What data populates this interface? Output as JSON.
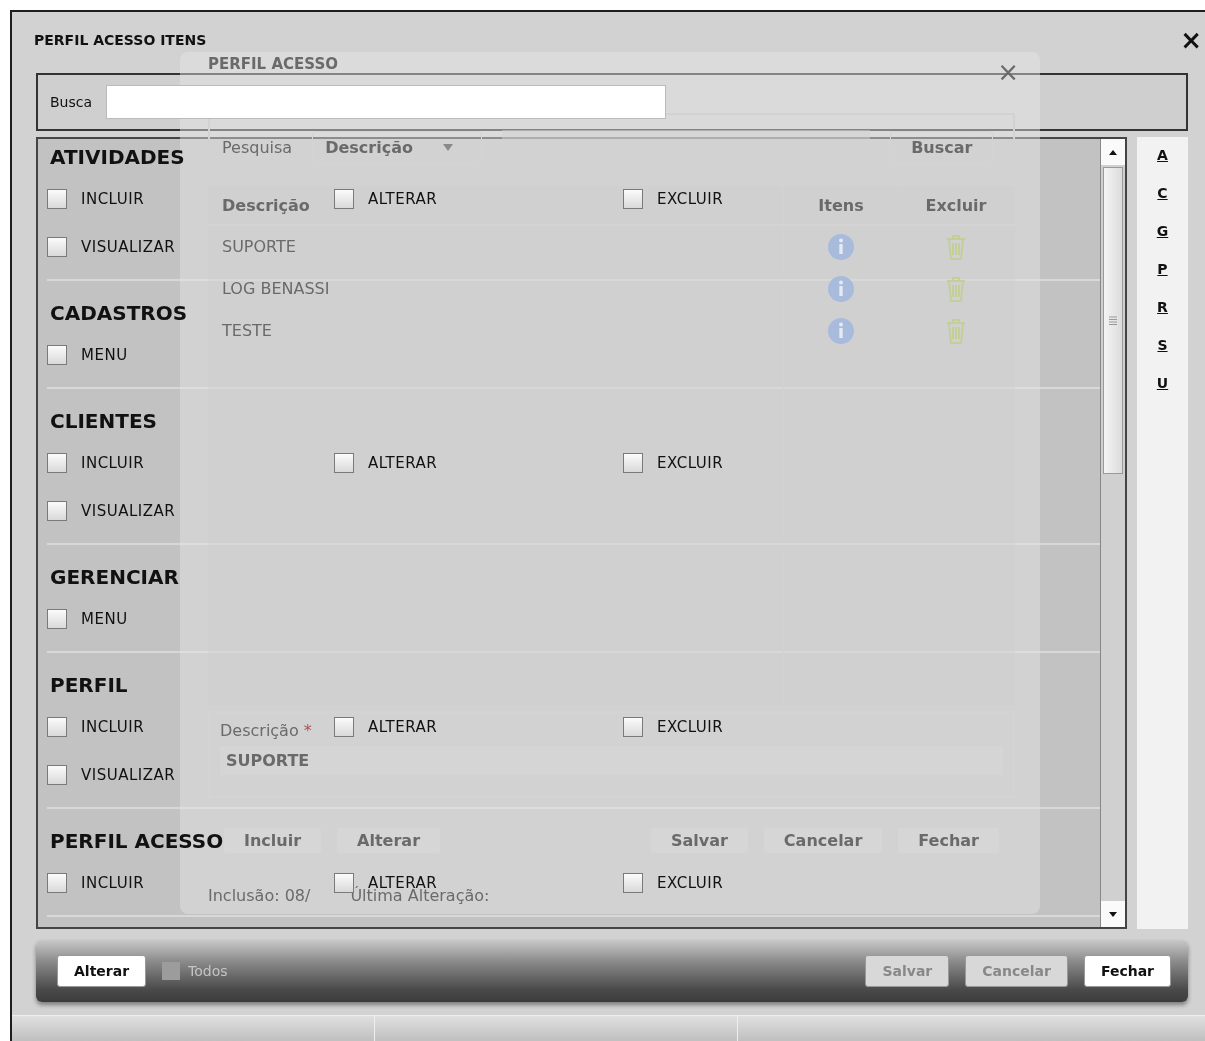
{
  "window": {
    "title": "PERFIL ACESSO ITENS",
    "close": "×"
  },
  "search": {
    "label": "Busca"
  },
  "sections": [
    {
      "title": "ATIVIDADES",
      "items": [
        {
          "label": "INCLUIR",
          "checked": false
        },
        {
          "label": "ALTERAR",
          "checked": false
        },
        {
          "label": "EXCLUIR",
          "checked": false
        },
        {
          "label": "VISUALIZAR",
          "checked": false
        }
      ]
    },
    {
      "title": "CADASTROS",
      "items": [
        {
          "label": "MENU",
          "checked": false
        }
      ]
    },
    {
      "title": "CLIENTES",
      "items": [
        {
          "label": "INCLUIR",
          "checked": false
        },
        {
          "label": "ALTERAR",
          "checked": false
        },
        {
          "label": "EXCLUIR",
          "checked": false
        },
        {
          "label": "VISUALIZAR",
          "checked": false
        }
      ]
    },
    {
      "title": "GERENCIAR",
      "items": [
        {
          "label": "MENU",
          "checked": false
        }
      ]
    },
    {
      "title": "PERFIL",
      "items": [
        {
          "label": "INCLUIR",
          "checked": false
        },
        {
          "label": "ALTERAR",
          "checked": false
        },
        {
          "label": "EXCLUIR",
          "checked": false
        },
        {
          "label": "VISUALIZAR",
          "checked": false
        }
      ]
    },
    {
      "title": "PERFIL ACESSO",
      "items": [
        {
          "label": "INCLUIR",
          "checked": false
        },
        {
          "label": "ALTERAR",
          "checked": false
        },
        {
          "label": "EXCLUIR",
          "checked": false
        }
      ]
    }
  ],
  "letter_index": [
    "A",
    "C",
    "G",
    "P",
    "R",
    "S",
    "U"
  ],
  "toolbar": {
    "left_buttons": [
      {
        "label": "Alterar",
        "disabled": false
      }
    ],
    "select_all": {
      "label": "Todos",
      "checked": false,
      "disabled": true
    },
    "right_buttons": [
      {
        "label": "Salvar",
        "disabled": true
      },
      {
        "label": "Cancelar",
        "disabled": true
      },
      {
        "label": "Fechar",
        "disabled": false
      }
    ]
  },
  "background_dialog": {
    "title": "PERFIL ACESSO",
    "close": "×",
    "search": {
      "label": "Pesquisa",
      "dropdown": "Descrição",
      "button": "Buscar"
    },
    "table": {
      "columns": [
        "Descrição",
        "Itens",
        "Excluir"
      ],
      "rows": [
        {
          "descricao": "SUPORTE"
        },
        {
          "descricao": "LOG BENASSI"
        },
        {
          "descricao": "TESTE"
        }
      ]
    },
    "form": {
      "label": "Descrição",
      "required_mark": "*",
      "value": "SUPORTE"
    },
    "buttons": [
      {
        "label": "Incluir"
      },
      {
        "label": "Alterar"
      },
      {
        "label": "Salvar"
      },
      {
        "label": "Cancelar"
      },
      {
        "label": "Fechar"
      }
    ],
    "footer": [
      "Inclusão: 08/",
      "Última Alteração:"
    ]
  }
}
